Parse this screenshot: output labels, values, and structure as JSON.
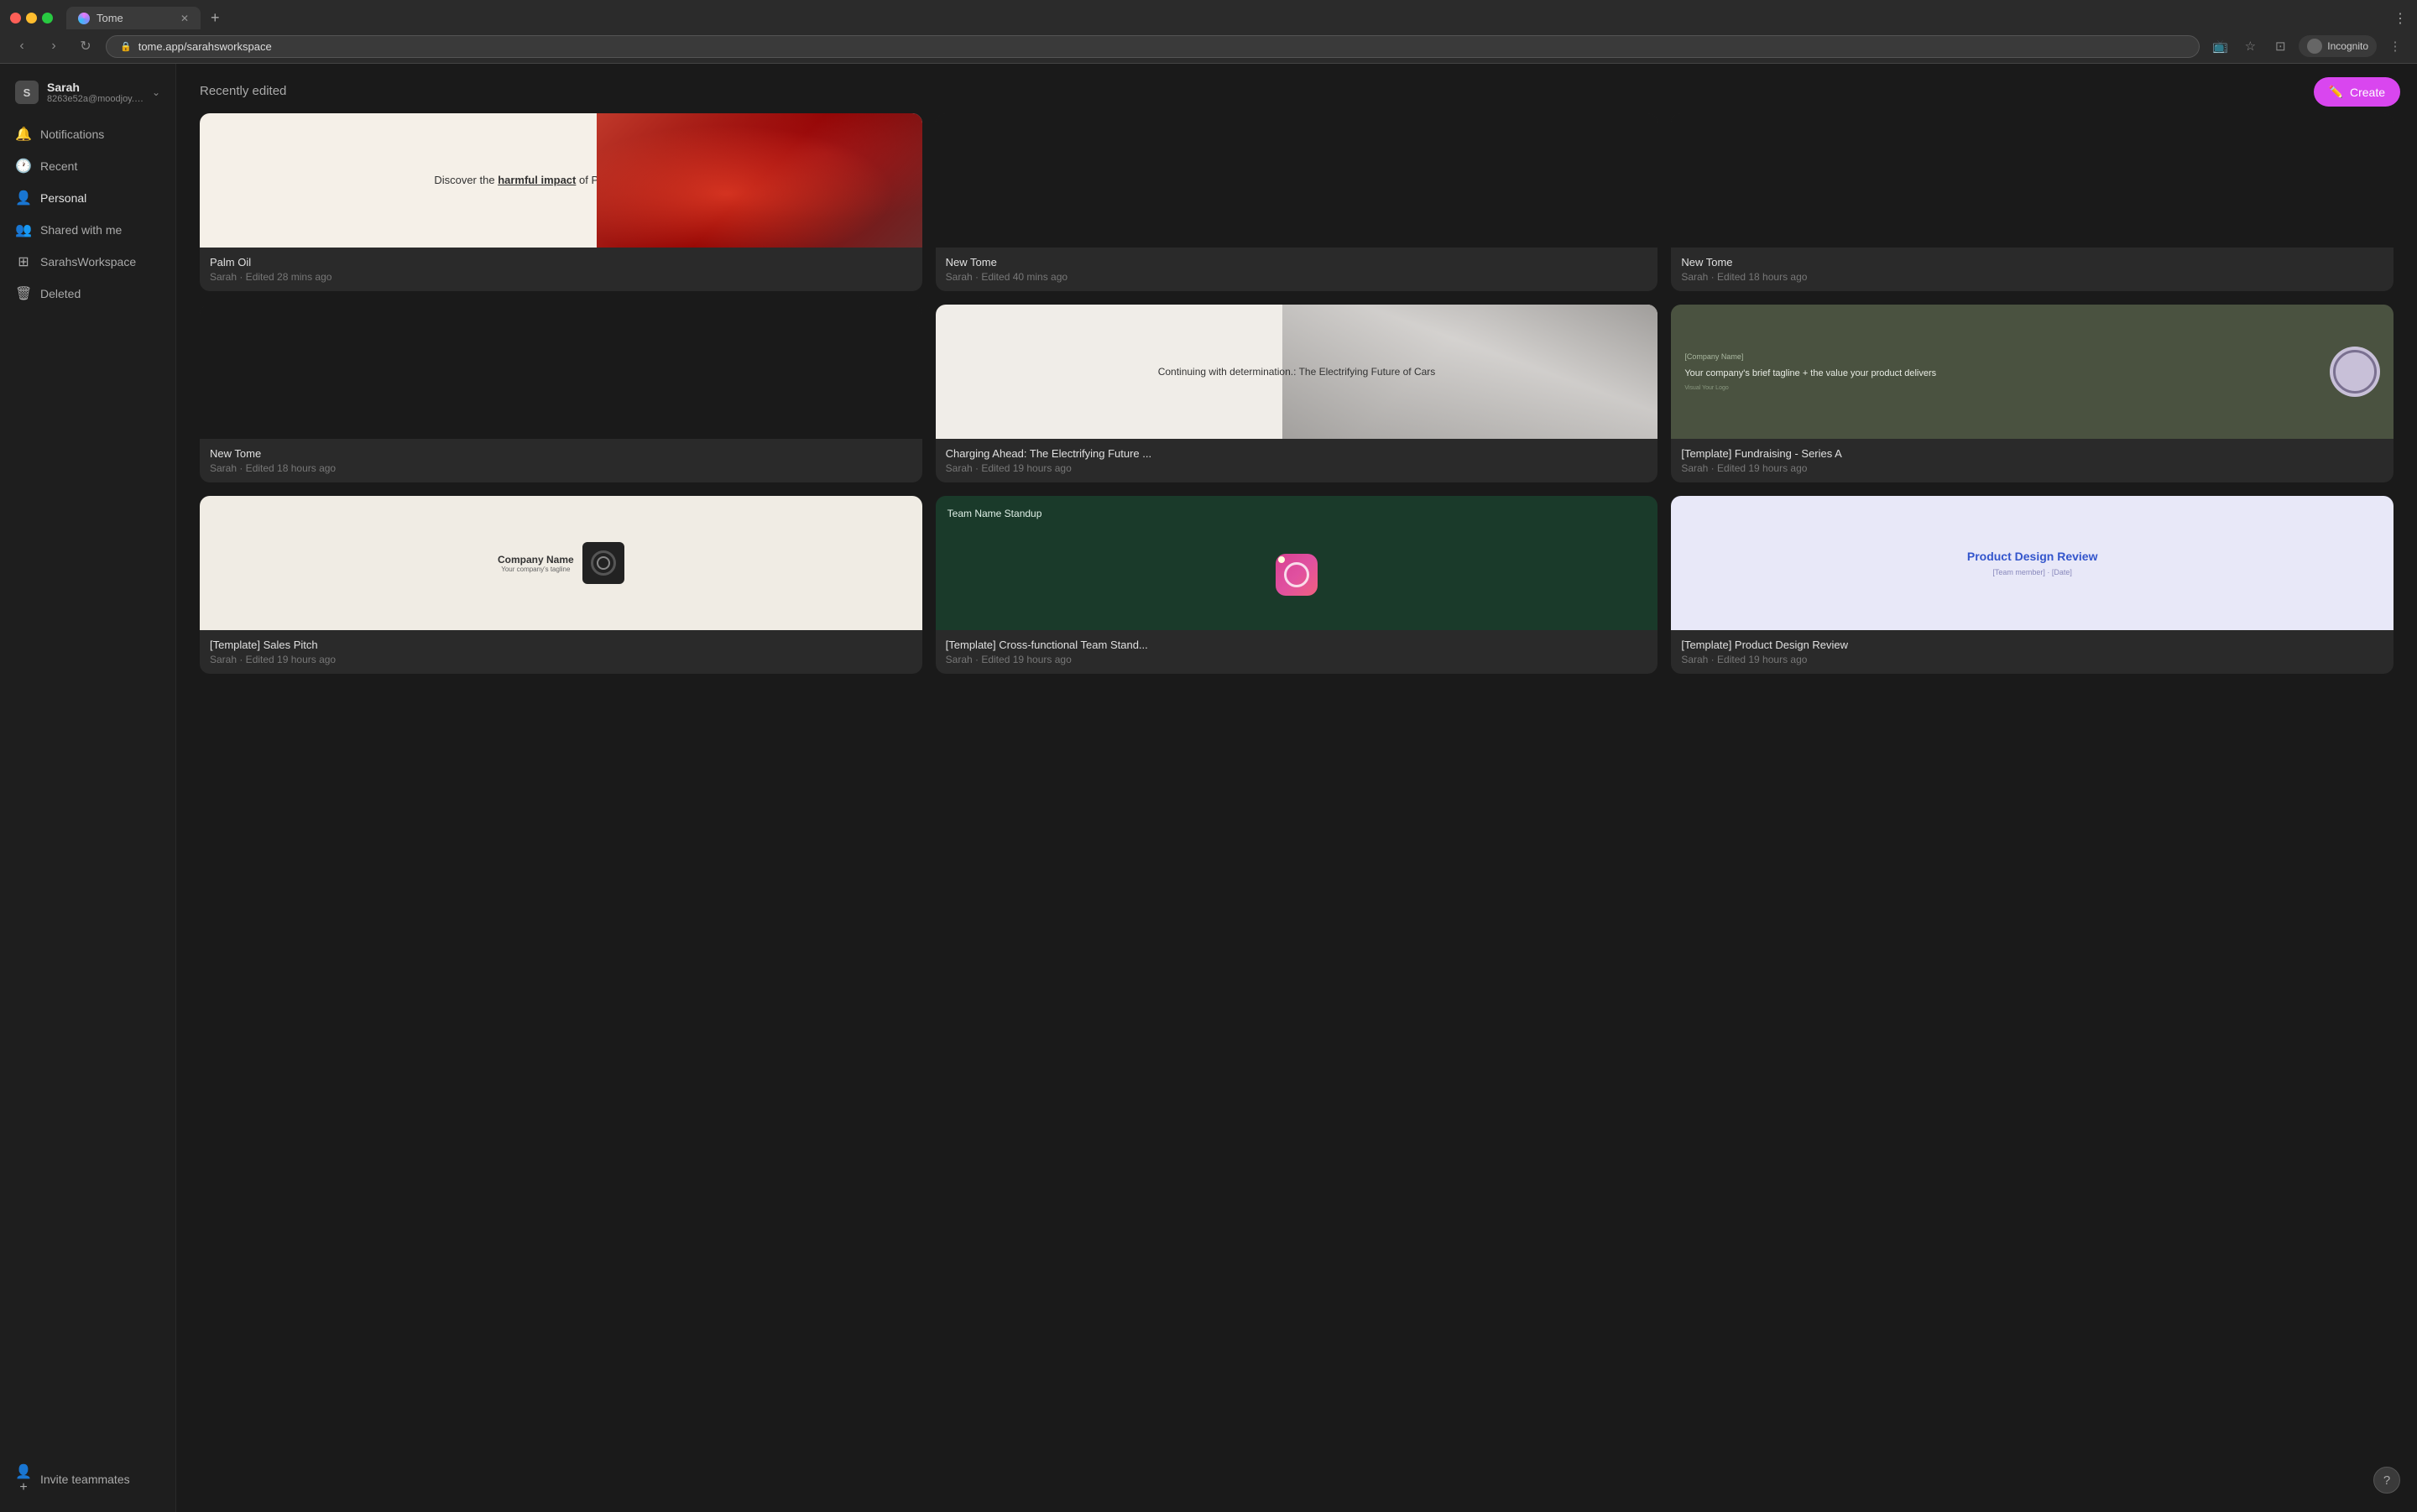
{
  "browser": {
    "tab_title": "Tome",
    "url": "tome.app/sarahsworkspace",
    "incognito_label": "Incognito"
  },
  "user": {
    "name": "Sarah",
    "email": "8263e52a@moodjoy.c...",
    "avatar_letter": "S"
  },
  "sidebar": {
    "notifications_label": "Notifications",
    "recent_label": "Recent",
    "personal_label": "Personal",
    "shared_label": "Shared with me",
    "workspace_label": "SarahsWorkspace",
    "deleted_label": "Deleted",
    "invite_label": "Invite teammates"
  },
  "main": {
    "section_title": "Recently edited",
    "create_label": "Create",
    "cards": [
      {
        "id": "palm-oil",
        "name": "Palm Oil",
        "meta": "Sarah · Edited 28 mins ago",
        "type": "palm-oil"
      },
      {
        "id": "new-tome-1",
        "name": "New Tome",
        "meta": "Sarah · Edited 40 mins ago",
        "type": "dark"
      },
      {
        "id": "new-tome-2",
        "name": "New Tome",
        "meta": "Sarah · Edited 18 hours ago",
        "type": "dark"
      },
      {
        "id": "new-tome-3",
        "name": "New Tome",
        "meta": "Sarah · Edited 18 hours ago",
        "type": "dark"
      },
      {
        "id": "charging",
        "name": "Charging Ahead: The Electrifying Future ...",
        "meta": "Sarah · Edited 19 hours ago",
        "type": "charging"
      },
      {
        "id": "fundraising",
        "name": "[Template] Fundraising - Series A",
        "meta": "Sarah · Edited 19 hours ago",
        "type": "fundraising"
      },
      {
        "id": "sales-pitch",
        "name": "[Template] Sales Pitch",
        "meta": "Sarah · Edited 19 hours ago",
        "type": "sales"
      },
      {
        "id": "crossfunc",
        "name": "[Template] Cross-functional Team Stand...",
        "meta": "Sarah · Edited 19 hours ago",
        "type": "crossfunc"
      },
      {
        "id": "product-design",
        "name": "[Template] Product Design Review",
        "meta": "Sarah · Edited 19 hours ago",
        "type": "product"
      }
    ]
  }
}
